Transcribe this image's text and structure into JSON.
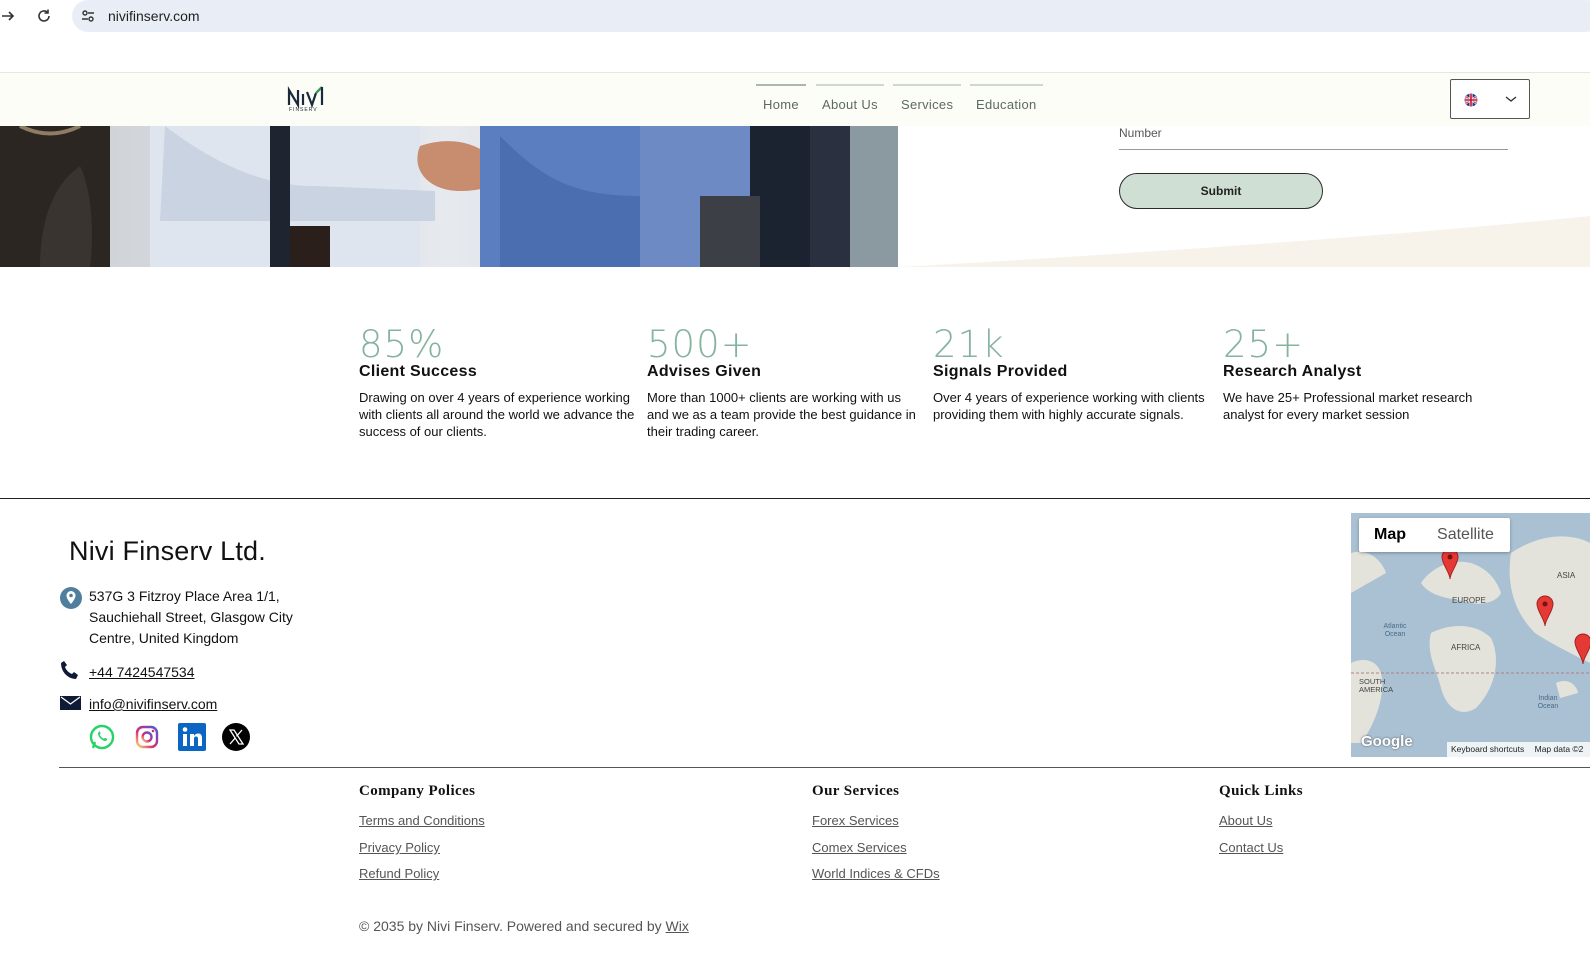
{
  "browser": {
    "url": "nivifinserv.com"
  },
  "nav": {
    "logo_text": "NiVi",
    "logo_sub": "FINSERV",
    "items": [
      {
        "label": "Home"
      },
      {
        "label": "About Us"
      },
      {
        "label": "Services"
      },
      {
        "label": "Education"
      }
    ],
    "language": "English"
  },
  "form": {
    "number_placeholder": "Number",
    "submit_label": "Submit"
  },
  "stats": [
    {
      "value": "85%",
      "title": "Client Success",
      "desc": "Drawing on over 4 years of experience working with clients all around the world we advance the success of our clients."
    },
    {
      "value": "500+",
      "title": "Advises Given",
      "desc": "More than 1000+ clients are working with us and we as a team provide the best guidance in their trading career."
    },
    {
      "value": "21k",
      "title": "Signals Provided",
      "desc": "Over 4 years of experience working with clients providing them with highly accurate signals."
    },
    {
      "value": "25+",
      "title": "Research Analyst",
      "desc": "We have 25+ Professional market research analyst for every market session"
    }
  ],
  "footer": {
    "company": "Nivi Finserv Ltd.",
    "address_lines": [
      "537G 3 Fitzroy Place Area 1/1,",
      "Sauchiehall Street, Glasgow City",
      "Centre, United Kingdom"
    ],
    "phone": "+44 7424547534",
    "email": "info@nivifinserv.com",
    "social": [
      "whatsapp-icon",
      "instagram-icon",
      "linkedin-icon",
      "x-icon"
    ],
    "map": {
      "tab_map": "Map",
      "tab_satellite": "Satellite",
      "labels": [
        "ASIA",
        "EUROPE",
        "Atlantic Ocean",
        "AFRICA",
        "SOUTH AMERICA",
        "Indian Ocean"
      ],
      "google": "Google",
      "shortcuts": "Keyboard shortcuts",
      "mapdata": "Map data ©2"
    },
    "columns": [
      {
        "heading": "Company Polices",
        "links": [
          "Terms and Conditions",
          "Privacy Policy",
          "Refund Policy"
        ]
      },
      {
        "heading": "Our Services",
        "links": [
          "Forex Services",
          "Comex Services",
          "World Indices & CFDs"
        ]
      },
      {
        "heading": "Quick Links",
        "links": [
          "About Us",
          "Contact Us"
        ]
      }
    ],
    "copyright_prefix": "© 2035 by Nivi Finserv. Powered and secured by ",
    "copyright_link": "Wix"
  }
}
